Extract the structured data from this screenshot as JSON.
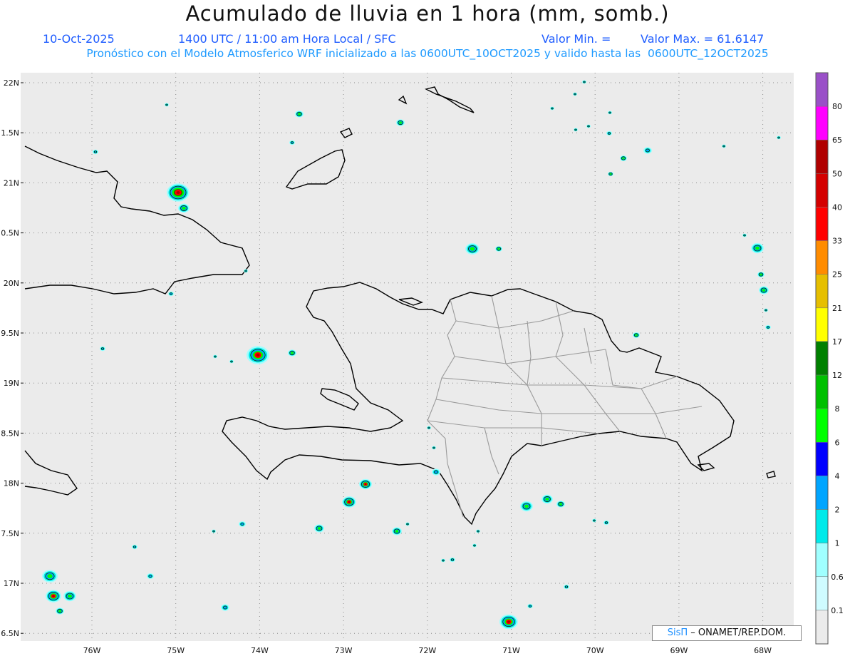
{
  "header": {
    "title": "Acumulado de lluvia en 1 hora (mm, somb.)",
    "date": "10-Oct-2025",
    "time": "1400 UTC / 11:00 am Hora Local / SFC",
    "min_label": "Valor Min. =",
    "max_label": "Valor Max. = 61.6147",
    "model_line": "Pronóstico con el Modelo Atmosferico WRF inicializado a las 0600UTC_10OCT2025 y valido hasta las  0600UTC_12OCT2025"
  },
  "map": {
    "lat_labels": [
      "22N",
      "1.5N",
      "21N",
      "0.5N",
      "20N",
      "9.5N",
      "19N",
      "8.5N",
      "18N",
      "7.5N",
      "17N",
      "6.5N"
    ],
    "lon_labels": [
      "76W",
      "75W",
      "74W",
      "73W",
      "72W",
      "71W",
      "70W",
      "69W",
      "68W"
    ],
    "land_color": "#ebebeb",
    "coast_color": "#000000",
    "province_color": "#9a9a9a"
  },
  "colorbar": {
    "levels": [
      "0.1",
      "0.6",
      "1",
      "2",
      "4",
      "6",
      "8",
      "12",
      "17",
      "21",
      "25",
      "33",
      "40",
      "50",
      "65",
      "80"
    ],
    "colors": [
      "#ebebeb",
      "#cffbff",
      "#a0ffff",
      "#00eaea",
      "#00a5ff",
      "#0000ff",
      "#00ff00",
      "#00c000",
      "#008000",
      "#ffff00",
      "#e6bf00",
      "#ff8c00",
      "#ff0000",
      "#d40000",
      "#b00000",
      "#ff00ff",
      "#9a50c8"
    ]
  },
  "credit": {
    "logo": "SisΠ",
    "text": "– ONAMET/REP.DOM."
  },
  "chart_data": {
    "type": "heatmap",
    "title": "Acumulado de lluvia en 1 hora (mm, somb.)",
    "max_value": 61.6147,
    "lon_range": [
      -76.6,
      -67.6
    ],
    "lat_range": [
      16.45,
      22.1
    ]
  }
}
